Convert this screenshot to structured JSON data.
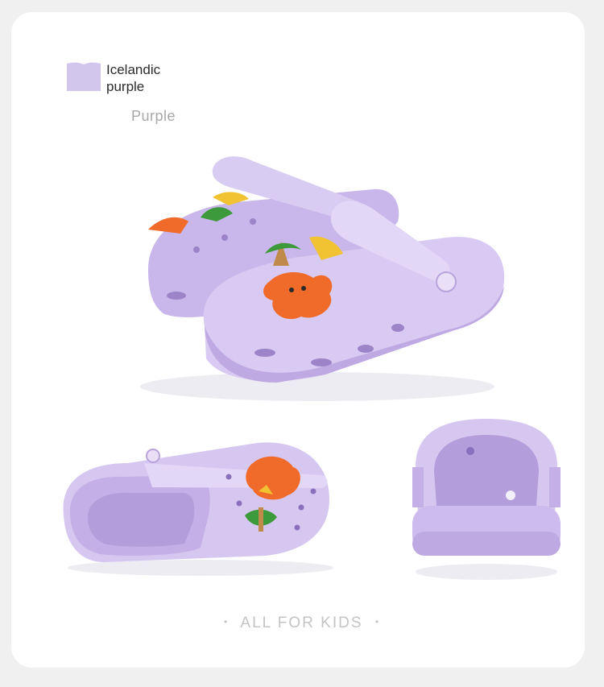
{
  "swatch": {
    "name_line1": "Icelandic",
    "name_line2": "purple",
    "label": "Purple",
    "color": "#d3c6ec"
  },
  "tagline": {
    "dot_left": "•",
    "text": "ALL FOR KIDS",
    "dot_right": "•"
  },
  "colors": {
    "background": "#f0f0f0",
    "card": "#ffffff",
    "clog_body": "#d4c4ee",
    "clog_shadow": "#b8a3dc",
    "charm_orange": "#f06a2a",
    "charm_green": "#3c9a3a"
  }
}
